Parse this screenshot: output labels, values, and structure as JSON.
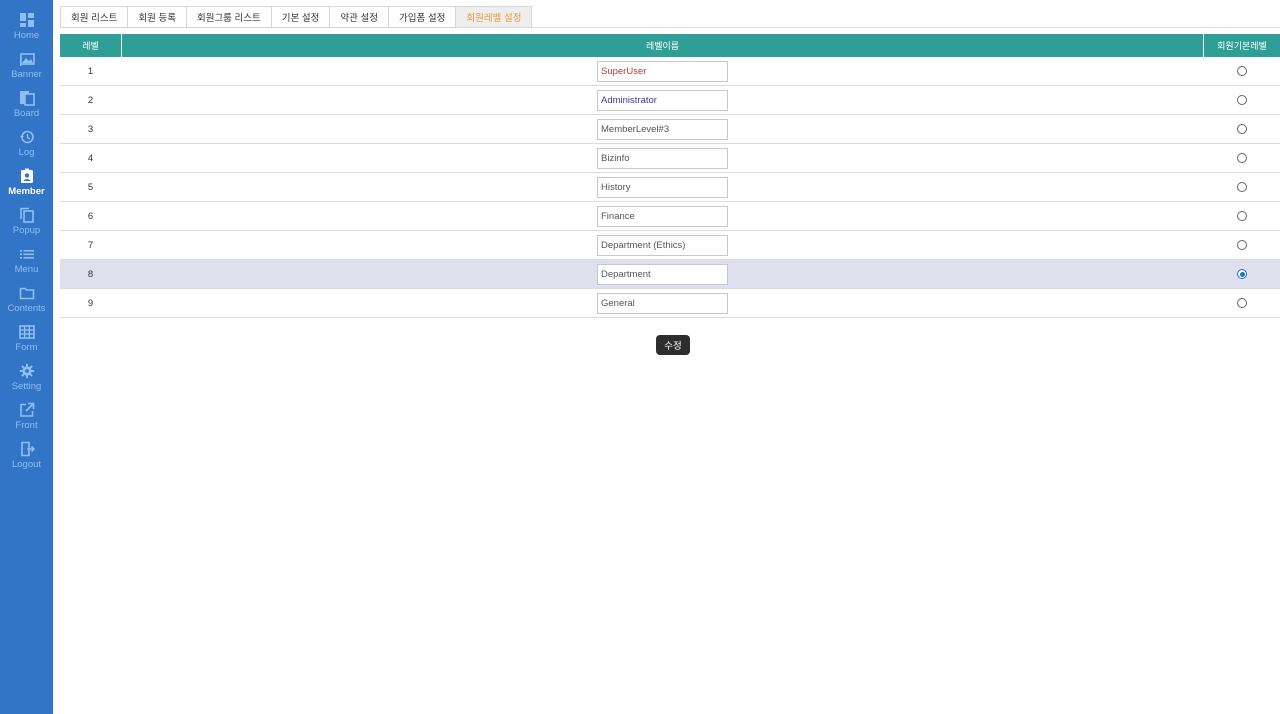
{
  "sidebar": {
    "items": [
      {
        "label": "Home",
        "icon": "dashboard-icon"
      },
      {
        "label": "Banner",
        "icon": "image-icon"
      },
      {
        "label": "Board",
        "icon": "documents-icon"
      },
      {
        "label": "Log",
        "icon": "history-icon"
      },
      {
        "label": "Member",
        "icon": "member-badge-icon",
        "active": true
      },
      {
        "label": "Popup",
        "icon": "copy-icon"
      },
      {
        "label": "Menu",
        "icon": "list-icon"
      },
      {
        "label": "Contents",
        "icon": "folder-icon"
      },
      {
        "label": "Form",
        "icon": "table-icon"
      },
      {
        "label": "Setting",
        "icon": "gear-icon"
      },
      {
        "label": "Front",
        "icon": "external-link-icon"
      },
      {
        "label": "Logout",
        "icon": "logout-icon"
      }
    ]
  },
  "tabs": [
    {
      "label": "회원 리스트"
    },
    {
      "label": "회원 등록"
    },
    {
      "label": "회원그룹 리스트"
    },
    {
      "label": "기본 설정"
    },
    {
      "label": "약관 설정"
    },
    {
      "label": "가입폼 설정"
    },
    {
      "label": "회원레벨 설정",
      "active": true
    }
  ],
  "table": {
    "headers": {
      "level": "레벨",
      "name": "레벨이름",
      "default": "회원기본레벨"
    },
    "rows": [
      {
        "level": "1",
        "name": "SuperUser",
        "color": "#c0392b",
        "default": false
      },
      {
        "level": "2",
        "name": "Administrator",
        "color": "#3b3b8f",
        "default": false
      },
      {
        "level": "3",
        "name": "MemberLevel#3",
        "color": "#555555",
        "default": false
      },
      {
        "level": "4",
        "name": "Bizinfo",
        "color": "#555555",
        "default": false
      },
      {
        "level": "5",
        "name": "History",
        "color": "#555555",
        "default": false
      },
      {
        "level": "6",
        "name": "Finance",
        "color": "#555555",
        "default": false
      },
      {
        "level": "7",
        "name": "Department (Ethics)",
        "color": "#555555",
        "default": false
      },
      {
        "level": "8",
        "name": "Department",
        "color": "#555555",
        "default": true
      },
      {
        "level": "9",
        "name": "General",
        "color": "#555555",
        "default": false
      }
    ]
  },
  "actions": {
    "submit_label": "수정"
  },
  "colors": {
    "sidebar": "#3274c6",
    "header": "#2e9e97",
    "active_tab_text": "#e89b3c",
    "selected_row": "#dfdfee"
  }
}
